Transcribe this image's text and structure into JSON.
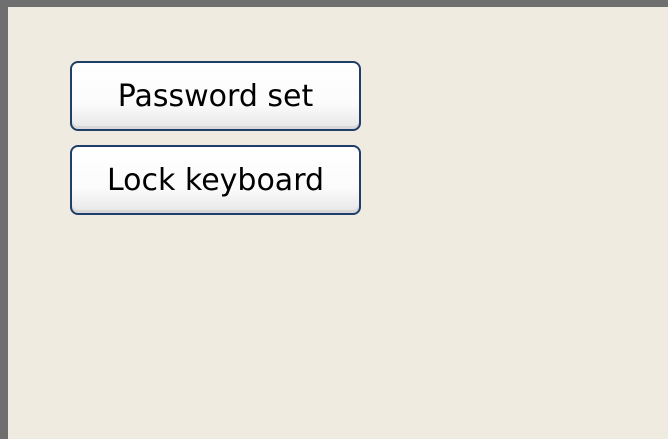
{
  "menu": {
    "password_set_label": "Password set",
    "lock_keyboard_label": "Lock keyboard"
  },
  "colors": {
    "background": "#f0ebe0",
    "frame": "#6f6f6f",
    "button_border": "#1f3e6a",
    "button_fill": "#ffffff"
  }
}
